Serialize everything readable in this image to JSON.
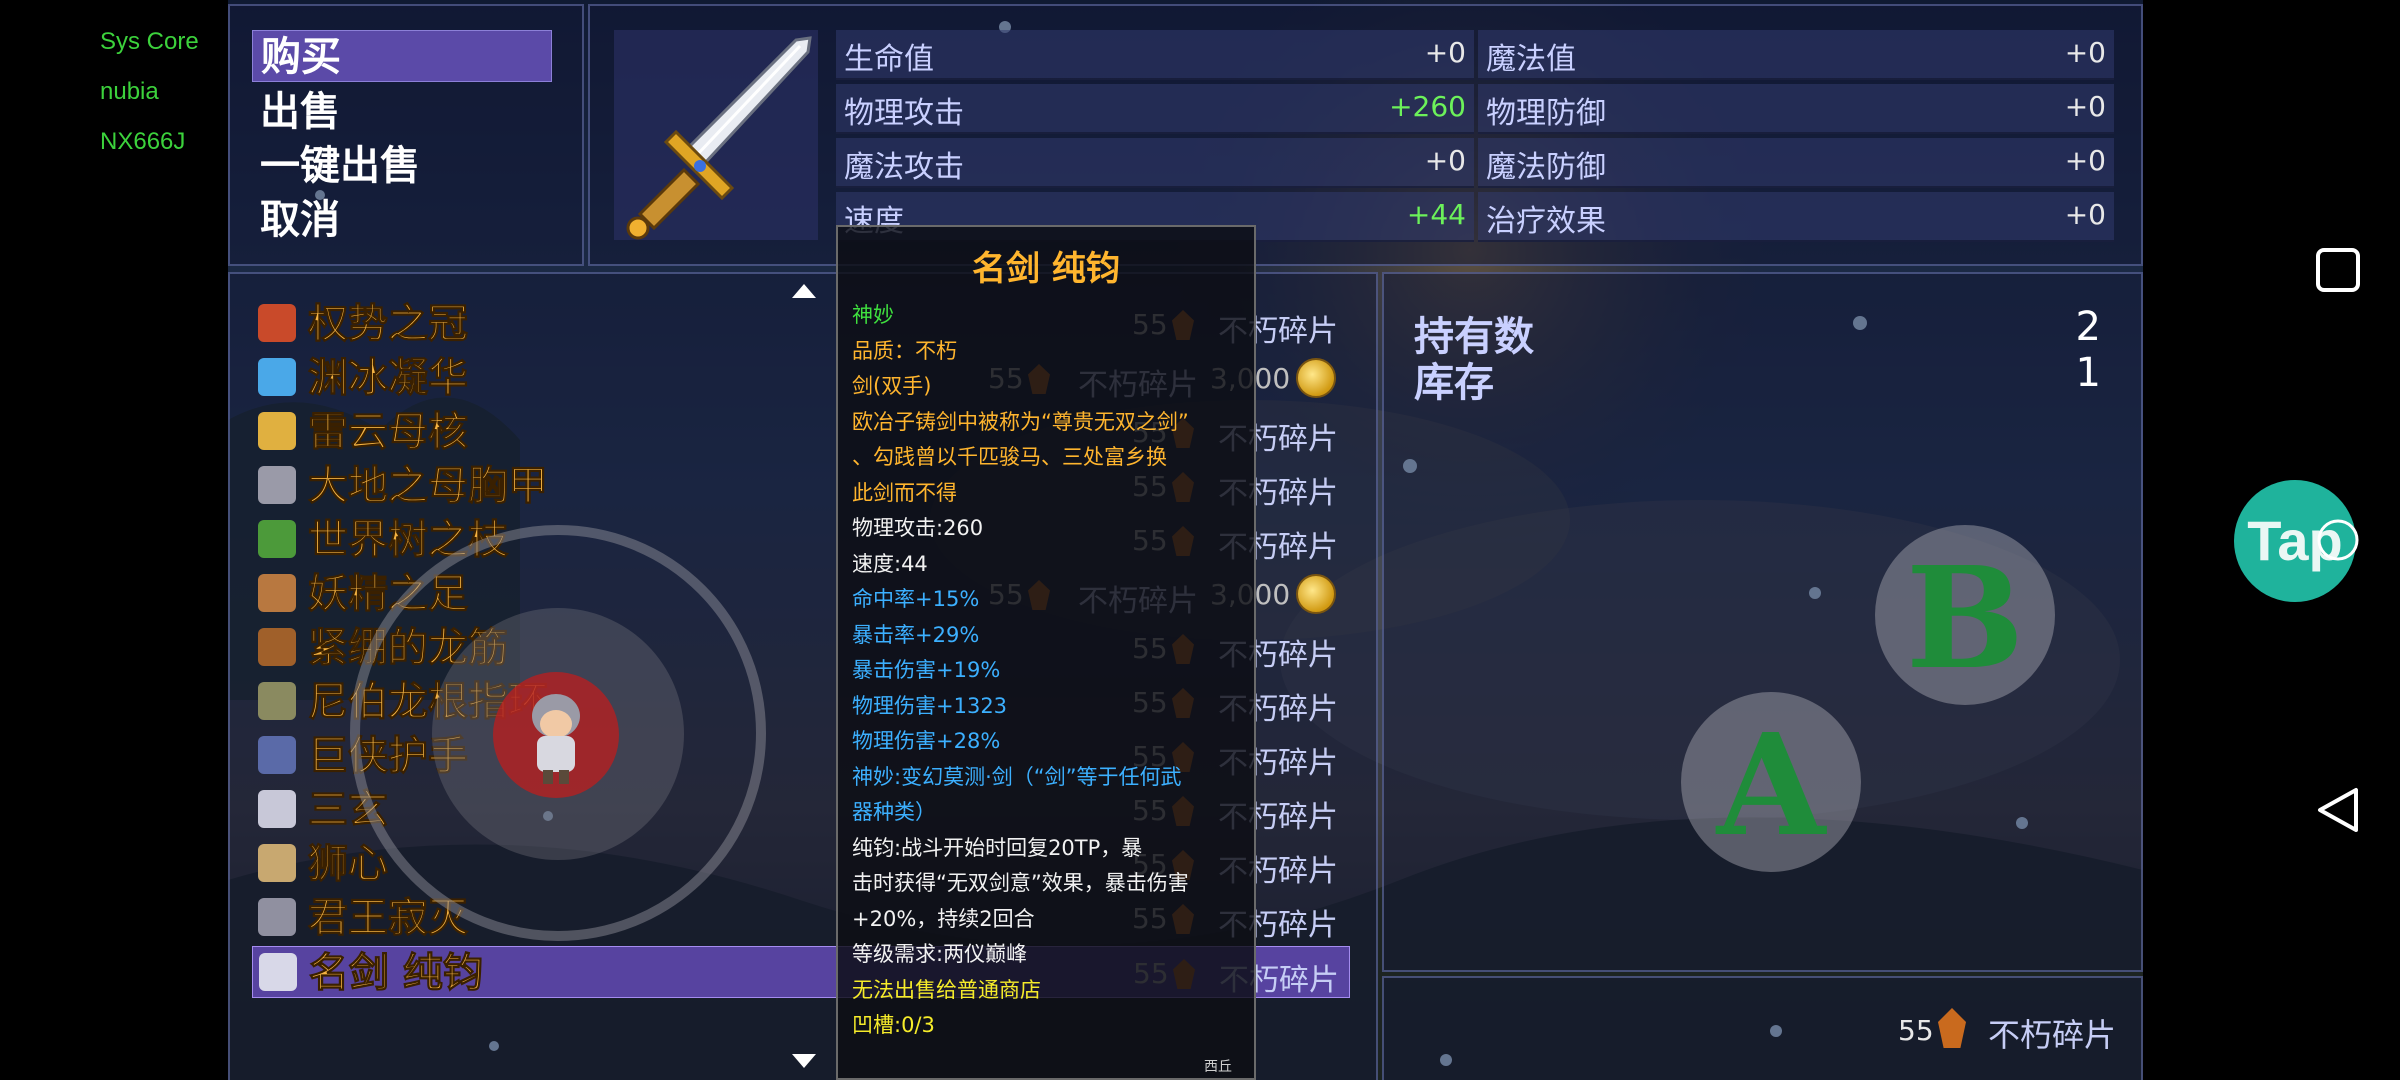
{
  "system_overlay": [
    "Sys Core",
    "nubia",
    "NX666J"
  ],
  "commands": [
    "购买",
    "出售",
    "一键出售",
    "取消"
  ],
  "stats": [
    {
      "name": "生命值",
      "value": "+0",
      "highlight": false
    },
    {
      "name": "魔法值",
      "value": "+0",
      "highlight": false
    },
    {
      "name": "物理攻击",
      "value": "+260",
      "highlight": true
    },
    {
      "name": "物理防御",
      "value": "+0",
      "highlight": false
    },
    {
      "name": "魔法攻击",
      "value": "+0",
      "highlight": false
    },
    {
      "name": "魔法防御",
      "value": "+0",
      "highlight": false
    },
    {
      "name": "速度",
      "value": "+44",
      "highlight": true
    },
    {
      "name": "治疗效果",
      "value": "+0",
      "highlight": false
    }
  ],
  "items": [
    {
      "name": "权势之冠",
      "icon": "crown-icon",
      "price": "55",
      "currency": "不朽碎片",
      "icon_color": "#c94a2a"
    },
    {
      "name": "渊冰凝华",
      "icon": "ice-crystal-icon",
      "price": "55",
      "currency": "不朽碎片",
      "coin_price": "3,000",
      "icon_color": "#4aa8e8"
    },
    {
      "name": "雷云母核",
      "icon": "thunder-core-icon",
      "price": "55",
      "currency": "不朽碎片",
      "icon_color": "#e0b040"
    },
    {
      "name": "大地之母胸甲",
      "icon": "armor-icon",
      "price": "55",
      "currency": "不朽碎片",
      "icon_color": "#9a9aa8"
    },
    {
      "name": "世界树之枝",
      "icon": "branch-icon",
      "price": "55",
      "currency": "不朽碎片",
      "icon_color": "#4c9a3a"
    },
    {
      "name": "妖精之足",
      "icon": "boots-icon",
      "price": "55",
      "currency": "不朽碎片",
      "coin_price": "3,000",
      "icon_color": "#b87840"
    },
    {
      "name": "紧绷的龙筋",
      "icon": "sinew-icon",
      "price": "55",
      "currency": "不朽碎片",
      "icon_color": "#a0602a"
    },
    {
      "name": "尼伯龙根指环",
      "icon": "ring-icon",
      "price": "55",
      "currency": "不朽碎片",
      "icon_color": "#8a8a60"
    },
    {
      "name": "巨侠护手",
      "icon": "gauntlet-icon",
      "price": "55",
      "currency": "不朽碎片",
      "icon_color": "#5a6aa8"
    },
    {
      "name": "三玄",
      "icon": "blade-icon",
      "price": "55",
      "currency": "不朽碎片",
      "icon_color": "#c8c8d8"
    },
    {
      "name": "狮心",
      "icon": "lion-emblem-icon",
      "price": "55",
      "currency": "不朽碎片",
      "icon_color": "#c8a870"
    },
    {
      "name": "君王寂灭",
      "icon": "mace-icon",
      "price": "55",
      "currency": "不朽碎片",
      "icon_color": "#9090a0"
    },
    {
      "name": "名剑 纯钧",
      "icon": "sword-icon",
      "price": "55",
      "currency": "不朽碎片",
      "icon_color": "#d8d8e8"
    }
  ],
  "selected_index": 12,
  "holdings": {
    "owned_label": "持有数",
    "owned_value": "2",
    "stock_label": "库存",
    "stock_value": "1"
  },
  "wallet": {
    "amount": "55",
    "currency": "不朽碎片"
  },
  "tooltip": {
    "title": "名剑 纯钧",
    "rarity": "神妙",
    "quality": "品质：不朽",
    "type": "剑(双手)",
    "desc": [
      "欧冶子铸剑中被称为“尊贵无双之剑”",
      "、勾践曾以千匹骏马、三处富乡换",
      "此剑而不得"
    ],
    "base": [
      "物理攻击:260",
      "速度:44"
    ],
    "bonus": [
      "命中率+15%",
      "暴击率+29%",
      "暴击伤害+19%",
      "物理伤害+1323",
      "物理伤害+28%",
      "神妙:变幻莫测·剑（“剑”等于任何武",
      "器种类）"
    ],
    "special": [
      "纯钧:战斗开始时回复20TP，暴",
      "击时获得“无双剑意”效果，暴击伤害",
      "+20%，持续2回合"
    ],
    "level_req": "等级需求:两仪巅峰",
    "sell_note": "无法出售给普通商店",
    "sockets": "凹槽:0/3",
    "footer": "西丘"
  },
  "controls": {
    "a": "A",
    "b": "B",
    "tap": "Tap"
  }
}
